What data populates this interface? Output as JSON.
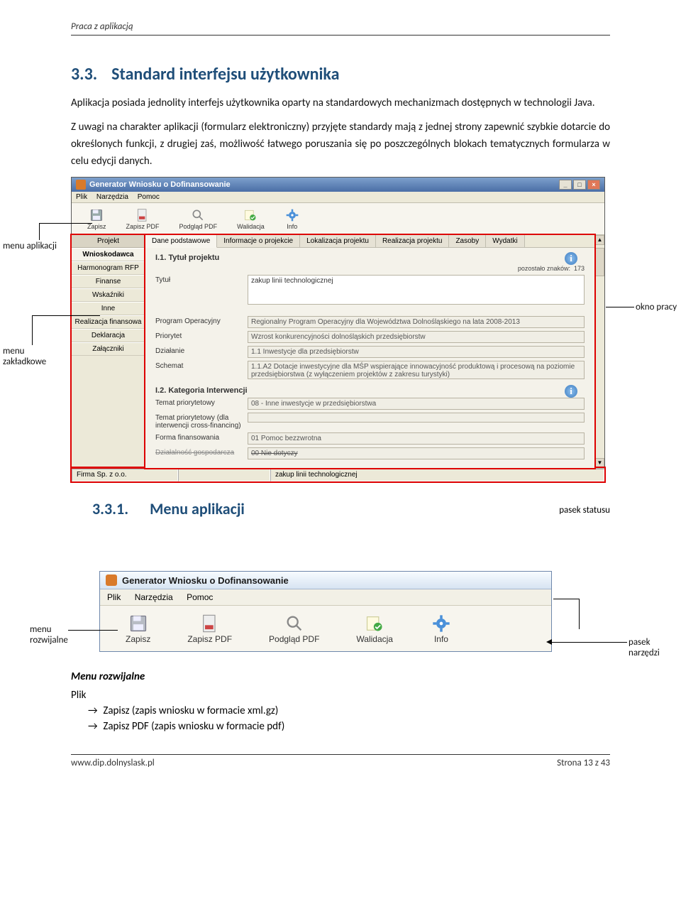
{
  "header": {
    "running_title": "Praca z aplikacją"
  },
  "section": {
    "num": "3.3.",
    "title": "Standard interfejsu użytkownika",
    "para1": "Aplikacja posiada jednolity interfejs użytkownika oparty na standardowych mechanizmach dostępnych w technologii Java.",
    "para2": "Z uwagi na charakter aplikacji (formularz elektroniczny) przyjęte standardy mają z jednej strony zapewnić szybkie dotarcie do określonych funkcji, z drugiej zaś, możliwość łatwego poruszania się po poszczególnych blokach tematycznych formularza w celu edycji danych."
  },
  "callouts": {
    "menu_aplikacji": "menu aplikacji",
    "menu_zakladkowe_1": "menu",
    "menu_zakladkowe_2": "zakładkowe",
    "okno_pracy": "okno pracy",
    "pasek_statusu": "pasek statusu",
    "menu_rozwijalne_1": "menu",
    "menu_rozwijalne_2": "rozwijalne",
    "pasek_narzedzi_1": "pasek",
    "pasek_narzedzi_2": "narzędzi"
  },
  "shot1": {
    "title": "Generator Wniosku o Dofinansowanie",
    "menu": [
      "Plik",
      "Narzędzia",
      "Pomoc"
    ],
    "toolbar": [
      "Zapisz",
      "Zapisz PDF",
      "Podgląd PDF",
      "Walidacja",
      "Info"
    ],
    "side_header": "Projekt",
    "side": [
      "Wnioskodawca",
      "Harmonogram RFP",
      "Finanse",
      "Wskaźniki",
      "Inne",
      "Realizacja finansowa",
      "Deklaracja",
      "Załączniki"
    ],
    "tabs": [
      "Dane podstawowe",
      "Informacje o projekcie",
      "Lokalizacja projektu",
      "Realizacja projektu",
      "Zasoby",
      "Wydatki"
    ],
    "section1": "I.1. Tytuł projektu",
    "remain_label": "pozostało znaków:",
    "remain_val": "173",
    "tytul_label": "Tytuł",
    "tytul_value": "zakup linii technologicznej",
    "rows": [
      {
        "label": "Program Operacyjny",
        "value": "Regionalny Program Operacyjny dla Województwa Dolnośląskiego na lata 2008-2013"
      },
      {
        "label": "Priorytet",
        "value": "Wzrost konkurencyjności dolnośląskich przedsiębiorstw"
      },
      {
        "label": "Działanie",
        "value": "1.1 Inwestycje dla przedsiębiorstw"
      },
      {
        "label": "Schemat",
        "value": "1.1.A2 Dotacje inwestycyjne dla MŚP wspierające innowacyjność produktową i procesową na poziomie przedsiębiorstwa (z wyłączeniem projektów z zakresu turystyki)"
      }
    ],
    "section2": "I.2. Kategoria Interwencji",
    "rows2": [
      {
        "label": "Temat priorytetowy",
        "value": "08 - Inne inwestycje w przedsiębiorstwa"
      },
      {
        "label": "Temat priorytetowy (dla interwencji cross-financing)",
        "value": ""
      },
      {
        "label": "Forma finansowania",
        "value": "01 Pomoc bezzwrotna"
      }
    ],
    "strike_row": {
      "label": "Działalność gospodarcza",
      "value": "00  Nie dotyczy"
    },
    "status": {
      "a": "Firma Sp. z o.o.",
      "b": "",
      "c": "zakup linii technologicznej"
    }
  },
  "subsection": {
    "num": "3.3.1.",
    "title": "Menu aplikacji"
  },
  "shot2": {
    "title": "Generator Wniosku o Dofinansowanie",
    "menu": [
      "Plik",
      "Narzędzia",
      "Pomoc"
    ],
    "toolbar": [
      "Zapisz",
      "Zapisz PDF",
      "Podgląd PDF",
      "Walidacja",
      "Info"
    ]
  },
  "after": {
    "sub_head": "Menu rozwijalne",
    "plik_label": "Plik",
    "item1": "Zapisz  (zapis wniosku w formacie xml.gz)",
    "item2": "Zapisz PDF (zapis wniosku w formacie pdf)"
  },
  "footer": {
    "left": "www.dip.dolnyslask.pl",
    "right": "Strona 13 z 43"
  }
}
